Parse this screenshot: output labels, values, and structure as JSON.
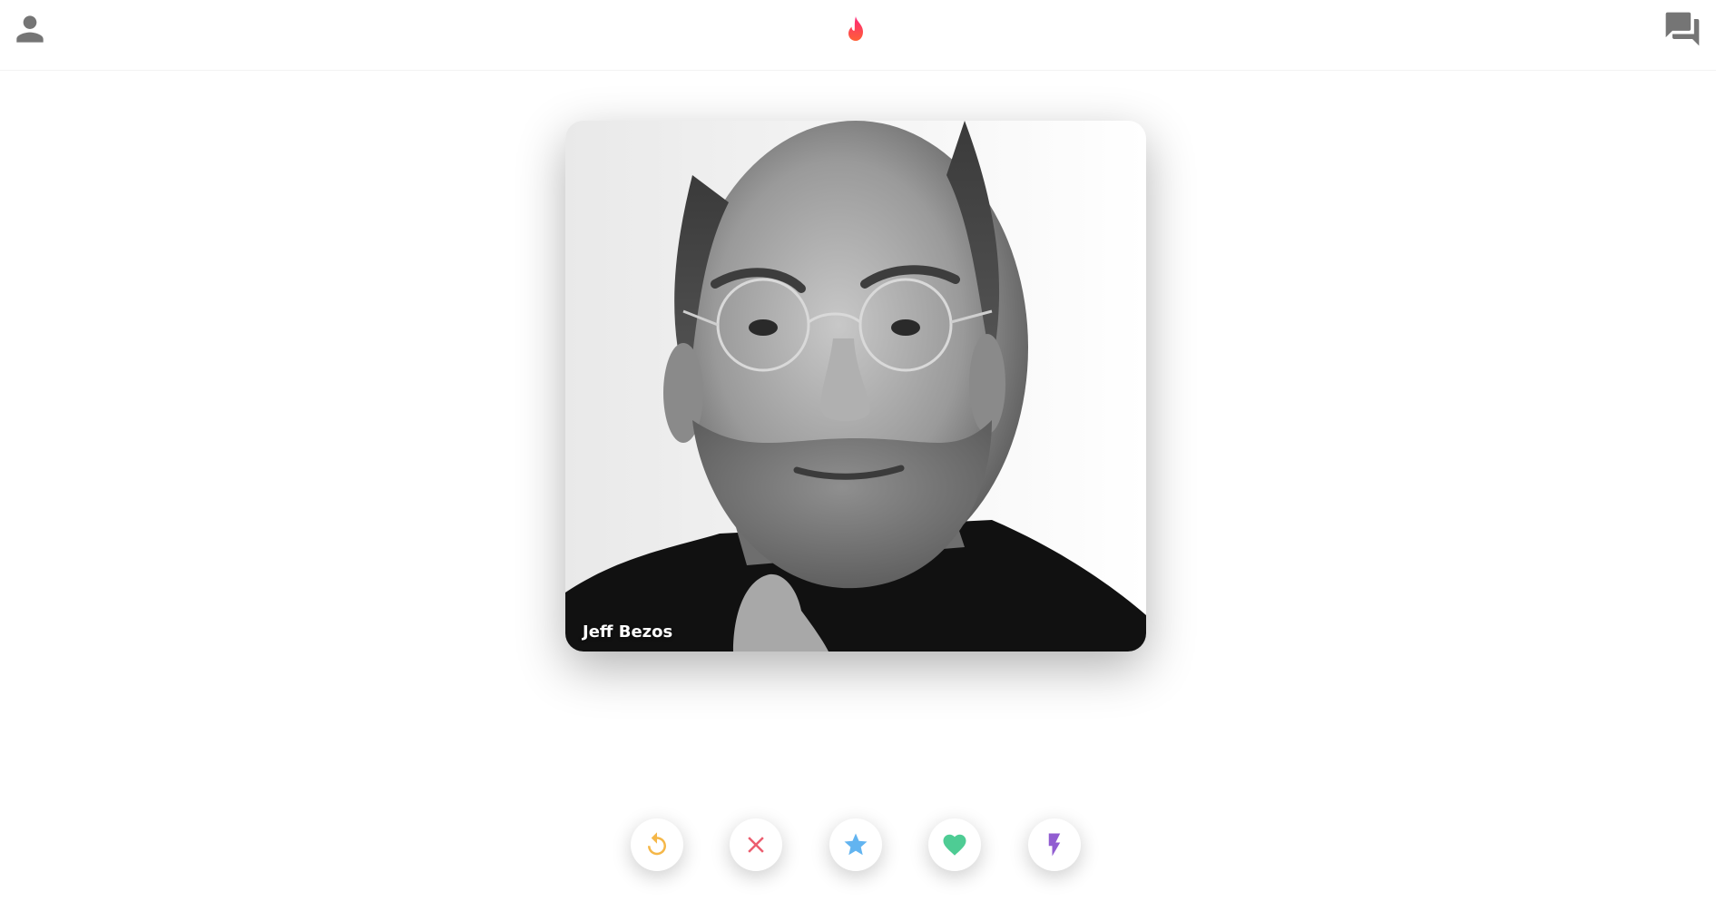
{
  "header": {
    "profile_icon": "person-icon",
    "logo_icon": "flame-icon",
    "chats_icon": "forum-icon",
    "logo_color_top": "#fd267a",
    "logo_color_bottom": "#ff6036"
  },
  "card": {
    "name": "Jeff Bezos",
    "photo": "grayscale-portrait"
  },
  "actions": [
    {
      "name": "rewind",
      "icon": "replay-icon",
      "color": "#f5b748"
    },
    {
      "name": "nope",
      "icon": "close-icon",
      "color": "#ec5e6f"
    },
    {
      "name": "super-like",
      "icon": "star-icon",
      "color": "#62b4f0"
    },
    {
      "name": "like",
      "icon": "heart-icon",
      "color": "#4ecc94"
    },
    {
      "name": "boost",
      "icon": "lightning-icon",
      "color": "#915dd1"
    }
  ]
}
